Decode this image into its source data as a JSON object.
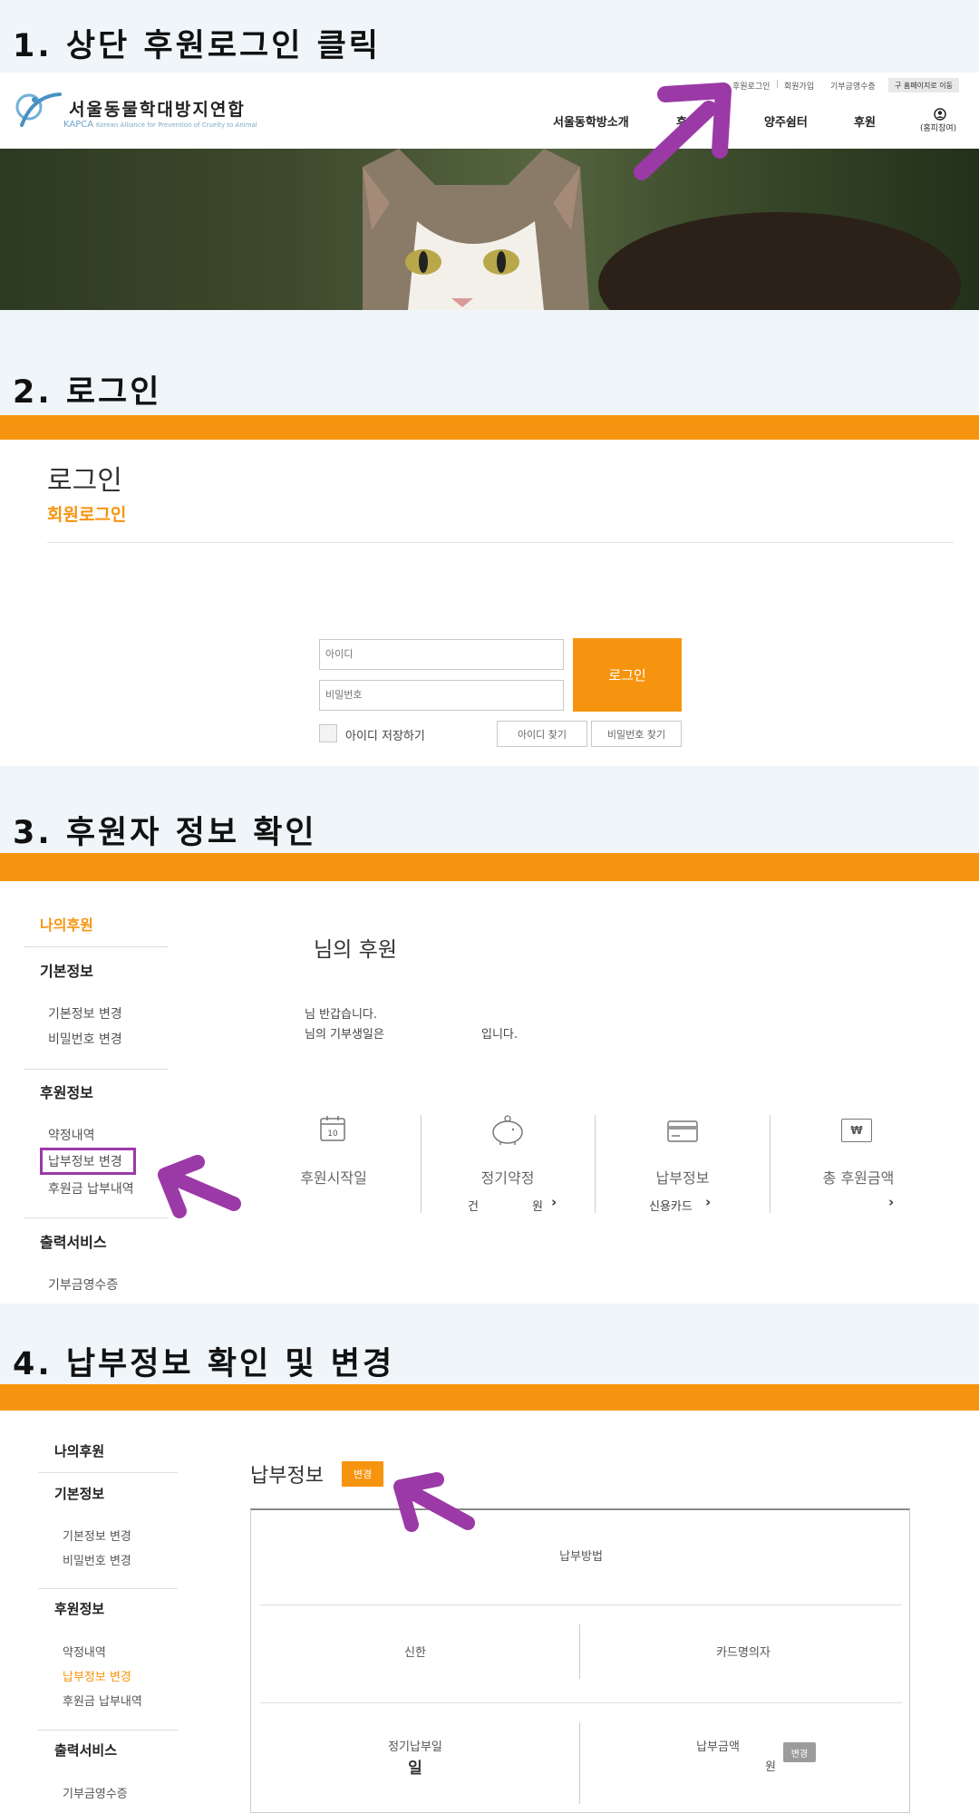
{
  "steps": [
    {
      "title": "1. 상단 후원로그인 클릭"
    },
    {
      "title": "2. 로그인"
    },
    {
      "title": "3. 후원자 정보 확인"
    },
    {
      "title": "4. 납부정보 확인 및 변경"
    }
  ],
  "site": {
    "logo_kor": "서울동물학대방지연합",
    "logo_sub_kapca": "KAPCA",
    "logo_sub_en": "Korean Alliance for Prevention of Cruelty to Animal",
    "top_links": [
      "후원로그인",
      "회원가입",
      "기부금영수증"
    ],
    "old_home_button": "구 홈페이지로 이동",
    "main_nav": [
      "서울동학방소개",
      "후",
      "양주쉼터",
      "후원"
    ],
    "login_icon_label": "(홈피참여)"
  },
  "login": {
    "title": "로그인",
    "subtitle": "회원로그인",
    "id_placeholder": "아이디",
    "pw_placeholder": "비밀번호",
    "login_button": "로그인",
    "remember_label": "아이디 저장하기",
    "find_id": "아이디 찾기",
    "find_pw": "비밀번호 찾기"
  },
  "mypage": {
    "sidebar_title": "나의후원",
    "basic_head": "기본정보",
    "basic_items": [
      "기본정보 변경",
      "비밀번호 변경"
    ],
    "support_head": "후원정보",
    "support_items": [
      "약정내역",
      "납부정보 변경",
      "후원금 납부내역"
    ],
    "print_head": "출력서비스",
    "print_items": [
      "기부금영수증"
    ],
    "heading": "님의 후원",
    "greet1": "님 반갑습니다.",
    "greet2a": "님의 기부생일은",
    "greet2b": "입니다.",
    "calendar_day": "10",
    "won_symbol": "₩",
    "stats": [
      {
        "label": "후원시작일",
        "sub": ""
      },
      {
        "label": "정기약정",
        "sub_a": "건",
        "sub_b": "원"
      },
      {
        "label": "납부정보",
        "sub": "신용카드"
      },
      {
        "label": "총 후원금액",
        "sub": ""
      }
    ]
  },
  "payment": {
    "sidebar_title": "나의후원",
    "basic_head": "기본정보",
    "basic_items": [
      "기본정보 변경",
      "비밀번호 변경"
    ],
    "support_head": "후원정보",
    "support_items": [
      "약정내역",
      "납부정보 변경",
      "후원금 납부내역"
    ],
    "print_head": "출력서비스",
    "print_items": [
      "기부금영수증"
    ],
    "title": "납부정보",
    "change_button": "변경",
    "method_label": "납부방법",
    "bank": "신한",
    "card_owner": "카드명의자",
    "pay_day_label": "정기납부일",
    "pay_day_unit": "일",
    "amount_label": "납부금액",
    "amount_unit": "원",
    "amount_change": "변경"
  },
  "colors": {
    "accent": "#f7940f",
    "arrow": "#9b3aa6",
    "step_bg": "#eff5f9"
  }
}
